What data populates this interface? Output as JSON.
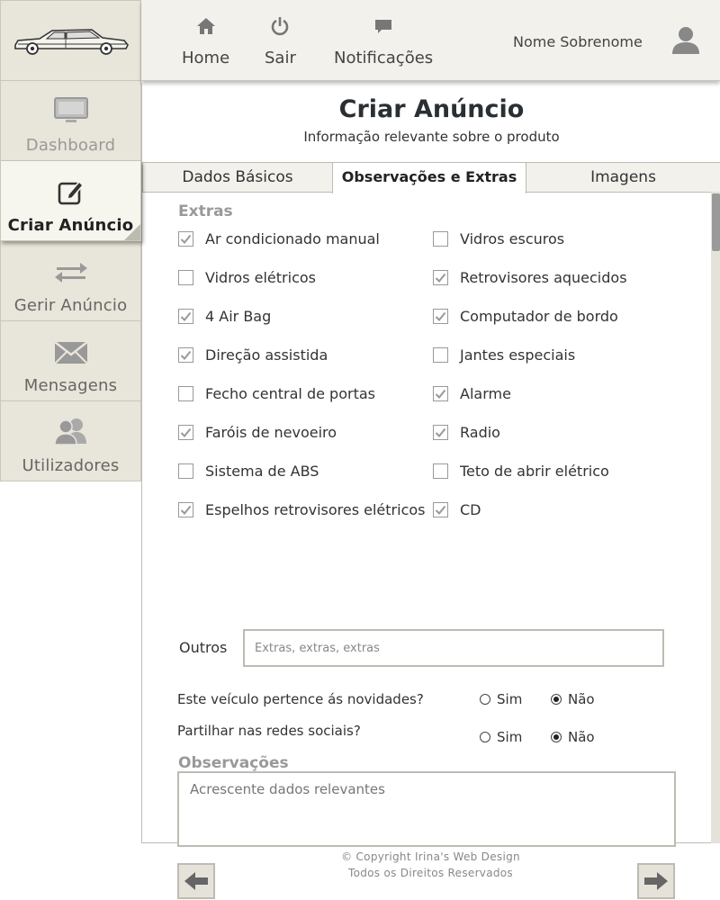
{
  "sidebar": {
    "items": [
      {
        "label": "Dashboard",
        "icon": "monitor-icon"
      },
      {
        "label": "Criar Anúncio",
        "icon": "edit-icon"
      },
      {
        "label": "Gerir Anúncio",
        "icon": "swap-icon"
      },
      {
        "label": "Mensagens",
        "icon": "envelope-icon"
      },
      {
        "label": "Utilizadores",
        "icon": "users-icon"
      }
    ]
  },
  "topbar": {
    "nav": [
      {
        "label": "Home",
        "icon": "home-icon"
      },
      {
        "label": "Sair",
        "icon": "power-icon"
      },
      {
        "label": "Notificações",
        "icon": "chat-icon"
      }
    ],
    "user_name": "Nome Sobrenome"
  },
  "page": {
    "title": "Criar Anúncio",
    "subtitle": "Informação relevante sobre o produto"
  },
  "tabs": [
    {
      "label": "Dados Básicos",
      "active": false
    },
    {
      "label": "Observações e Extras",
      "active": true
    },
    {
      "label": "Imagens",
      "active": false
    }
  ],
  "extras": {
    "heading": "Extras",
    "items": [
      {
        "label": "Ar condicionado manual",
        "checked": true
      },
      {
        "label": "Vidros escuros",
        "checked": false
      },
      {
        "label": "Vidros elétricos",
        "checked": false
      },
      {
        "label": "Retrovisores aquecidos",
        "checked": true
      },
      {
        "label": "4 Air Bag",
        "checked": true
      },
      {
        "label": "Computador de bordo",
        "checked": true
      },
      {
        "label": "Direção assistida",
        "checked": true
      },
      {
        "label": "Jantes especiais",
        "checked": false
      },
      {
        "label": "Fecho central de portas",
        "checked": false
      },
      {
        "label": "Alarme",
        "checked": true
      },
      {
        "label": "Faróis de nevoeiro",
        "checked": true
      },
      {
        "label": "Radio",
        "checked": true
      },
      {
        "label": "Sistema de ABS",
        "checked": false
      },
      {
        "label": "Teto de abrir elétrico",
        "checked": false
      },
      {
        "label": "Espelhos retrovisores elétricos",
        "checked": true
      },
      {
        "label": "CD",
        "checked": true
      }
    ],
    "outros_label": "Outros",
    "outros_placeholder": "Extras, extras, extras"
  },
  "questions": [
    {
      "text": "Este veículo pertence ás novidades?",
      "yes": "Sim",
      "no": "Não",
      "selected": "Não"
    },
    {
      "text": "Partilhar nas redes sociais?",
      "yes": "Sim",
      "no": "Não",
      "selected": "Não"
    }
  ],
  "observacoes": {
    "heading": "Observações",
    "placeholder": "Acrescente dados relevantes"
  },
  "footer": {
    "line1": "© Copyright Irina's Web Design",
    "line2": "Todos os Direitos Reservados"
  },
  "colors": {
    "sidebar_bg": "#e8e6da",
    "topbar_bg": "#f2f1eb",
    "border": "#bdbbb3",
    "heading_gray": "#999999"
  }
}
